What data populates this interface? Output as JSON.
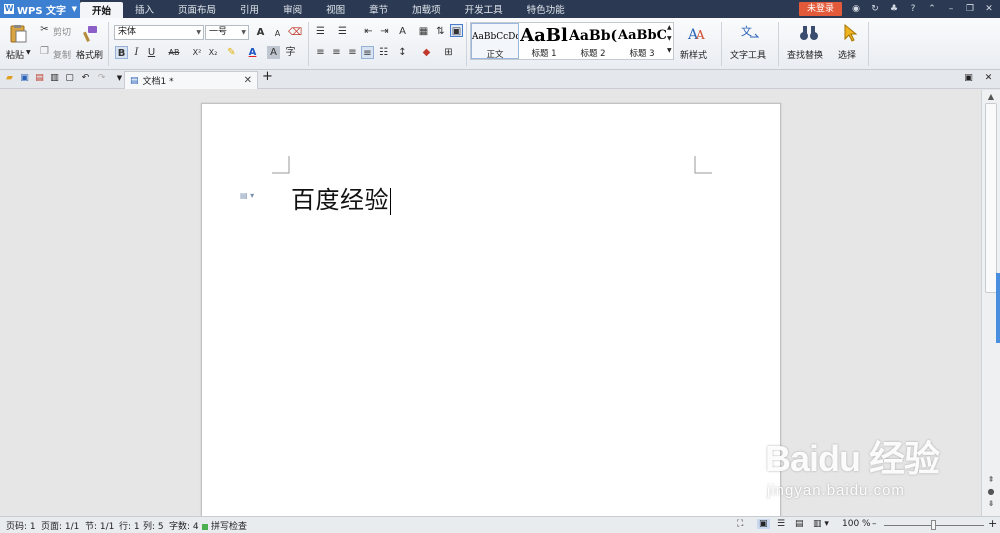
{
  "app": {
    "name": "WPS 文字"
  },
  "menu": {
    "tabs": [
      "开始",
      "插入",
      "页面布局",
      "引用",
      "审阅",
      "视图",
      "章节",
      "加载项",
      "开发工具",
      "特色功能"
    ],
    "active_index": 0,
    "login_label": "未登录",
    "help_label": "?"
  },
  "ribbon": {
    "paste_label": "粘贴",
    "cut_label": "剪切",
    "copy_label": "复制",
    "format_painter_label": "格式刷",
    "font_name": "宋体",
    "font_size": "一号",
    "bold": "B",
    "italic": "I",
    "underline": "U",
    "strike": "AB",
    "superscript": "X²",
    "subscript": "X₂",
    "grow_font": "A",
    "shrink_font": "A",
    "styles": [
      {
        "sample": "AaBbCcDd",
        "name": "正文"
      },
      {
        "sample": "AaBl",
        "name": "标题 1"
      },
      {
        "sample": "AaBb(",
        "name": "标题 2"
      },
      {
        "sample": "AaBbC",
        "name": "标题 3"
      }
    ],
    "new_style_label": "新样式",
    "text_tools_label": "文字工具",
    "find_replace_label": "查找替换",
    "select_label": "选择"
  },
  "doc_tab": {
    "title": "文档1 *"
  },
  "document": {
    "text": "百度经验"
  },
  "status": {
    "page_code": "页码: 1",
    "pages": "页面: 1/1",
    "section": "节: 1/1",
    "row": "行: 1",
    "col": "列: 5",
    "word_count": "字数: 4",
    "spell_check": "拼写检查",
    "zoom": "100 %",
    "zoom_minus": "–",
    "zoom_plus": "+",
    "zoom_level": 0.5
  },
  "watermark": {
    "main": "Baidu 经验",
    "sub": "jingyan.baidu.com"
  },
  "colors": {
    "titlebar": "#2b3a52",
    "wps_blue": "#3d7fd1",
    "login_red": "#e25a3a"
  }
}
